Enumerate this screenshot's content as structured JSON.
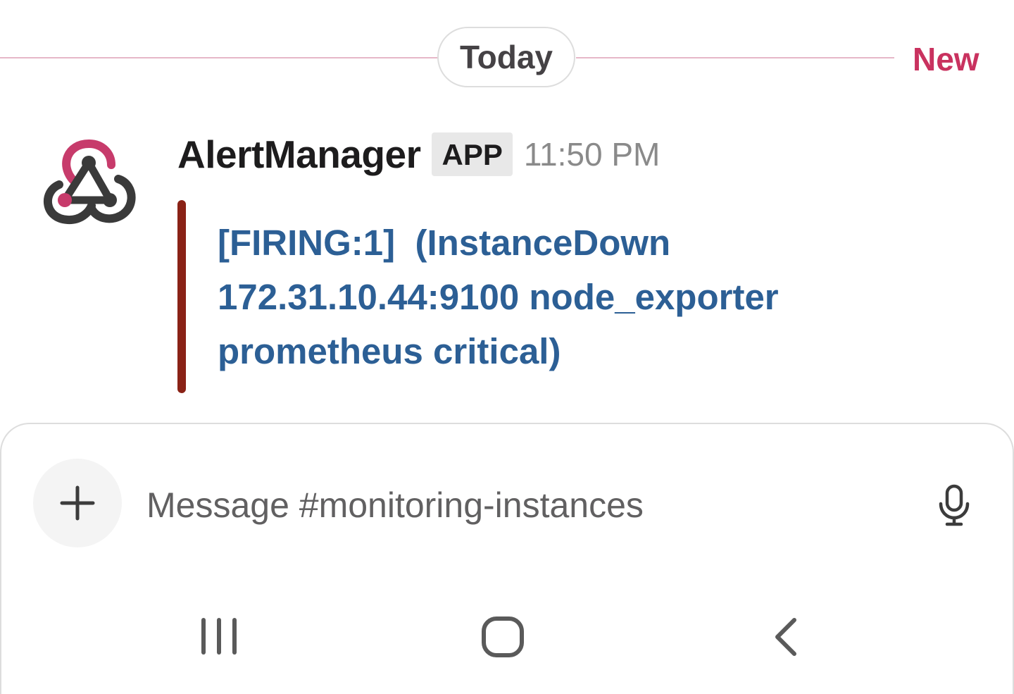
{
  "divider": {
    "date_label": "Today",
    "new_label": "New",
    "new_color": "#c9325f"
  },
  "message": {
    "avatar_icon": "webhook-icon",
    "sender": "AlertManager",
    "badge": "APP",
    "time": "11:50 PM",
    "attachment": {
      "bar_color": "#8a2216",
      "title": "[FIRING:1]  (InstanceDown\n172.31.10.44:9100 node_exporter\nprometheus critical)",
      "link_color": "#2c5f95"
    }
  },
  "composer": {
    "placeholder": "Message #monitoring-instances",
    "value": "",
    "add_icon": "plus-icon",
    "mic_icon": "microphone-icon"
  },
  "system_nav": {
    "recents_icon": "recents-icon",
    "home_icon": "home-icon",
    "back_icon": "back-icon"
  }
}
